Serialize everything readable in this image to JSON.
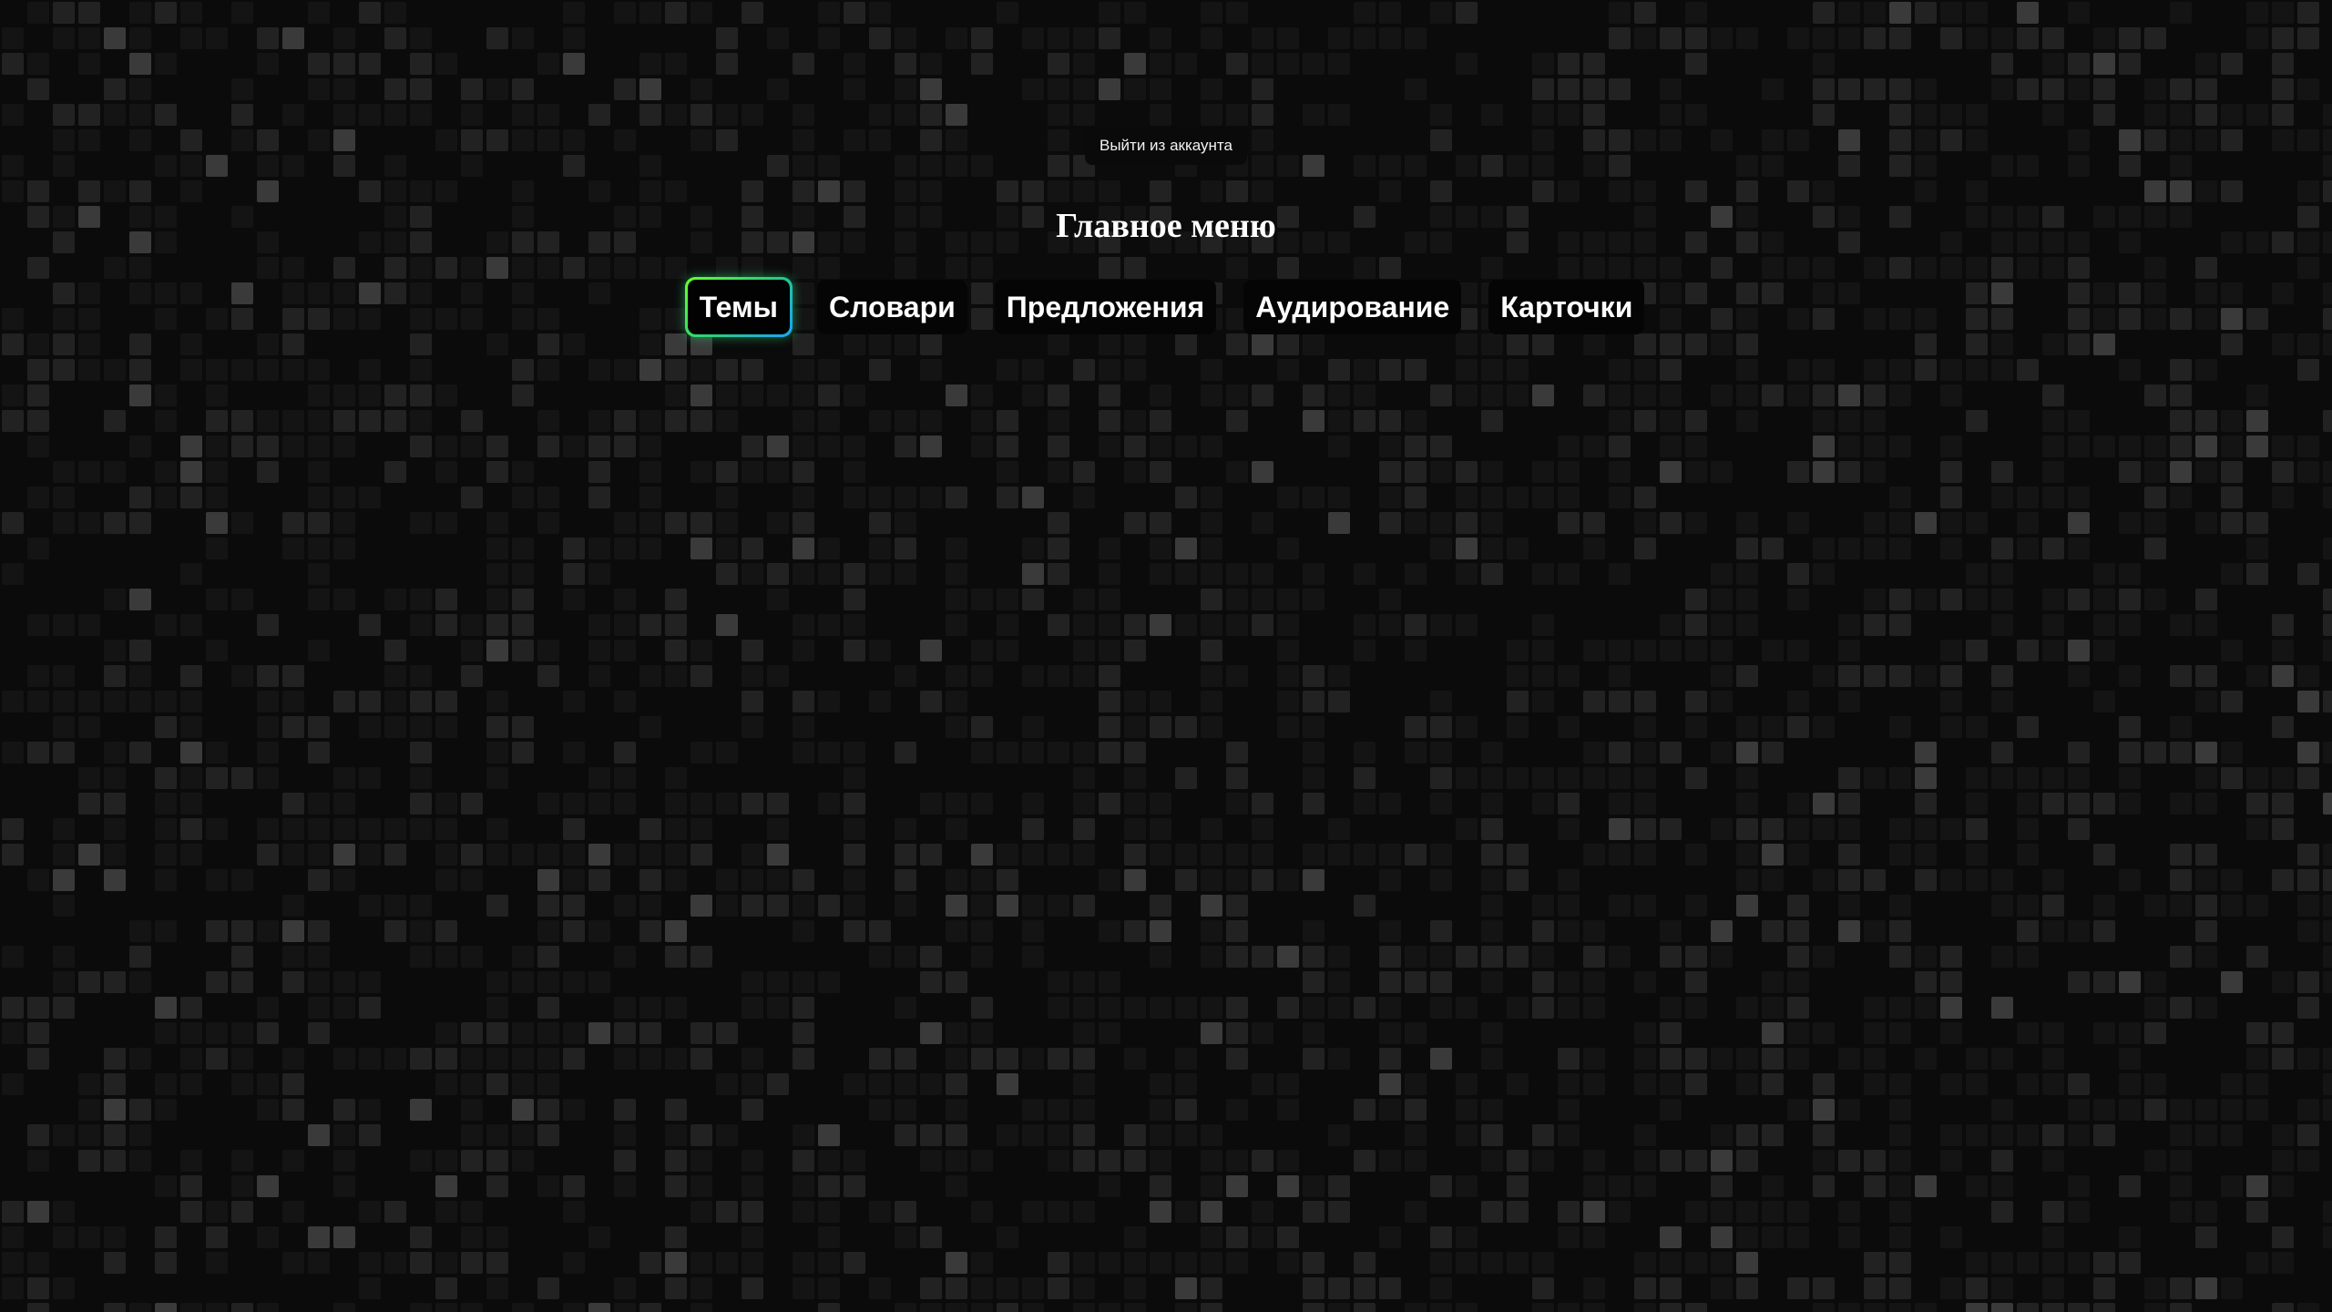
{
  "header": {
    "logout_label": "Выйти из аккаунта"
  },
  "main": {
    "title": "Главное меню",
    "menu_items": [
      {
        "label": "Темы",
        "active": true
      },
      {
        "label": "Словари",
        "active": false
      },
      {
        "label": "Предложения",
        "active": false
      },
      {
        "label": "Аудирование",
        "active": false
      },
      {
        "label": "Карточки",
        "active": false
      }
    ]
  },
  "colors": {
    "background": "#0b0b0b",
    "tile_dark": "#1a1a1a",
    "tile_light": "#2e2e2e",
    "active_glow_green": "#6cff2a",
    "active_glow_blue": "#1aa0ff",
    "button_background": "#050505",
    "text": "#ffffff"
  }
}
